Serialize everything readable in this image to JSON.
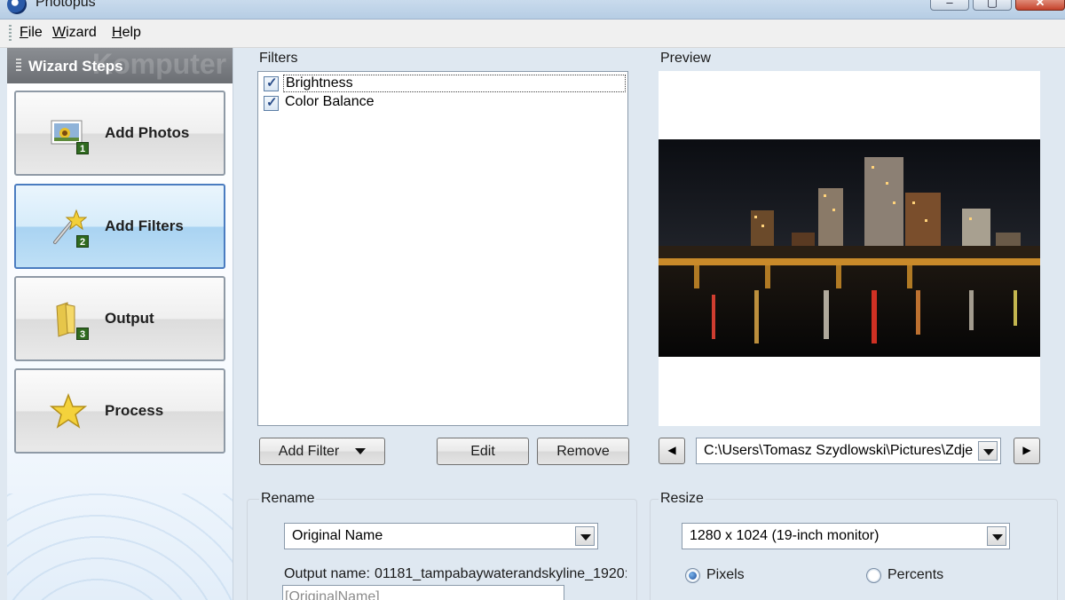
{
  "window": {
    "title": "Photopus",
    "controls": {
      "minimize": "–",
      "maximize": "▢",
      "close": "✕"
    }
  },
  "menu": {
    "items": [
      "File",
      "Wizard",
      "Help"
    ]
  },
  "wizard": {
    "header": "Wizard Steps",
    "watermark": "Komputer",
    "steps": [
      {
        "label": "Add Photos",
        "number": "1",
        "icon": "photo-icon"
      },
      {
        "label": "Add Filters",
        "number": "2",
        "icon": "magic-wand-icon",
        "active": true
      },
      {
        "label": "Output",
        "number": "3",
        "icon": "folder-icon"
      },
      {
        "label": "Process",
        "icon": "star-icon"
      }
    ]
  },
  "filters": {
    "label": "Filters",
    "items": [
      {
        "name": "Brightness",
        "checked": true,
        "selected": true
      },
      {
        "name": "Color Balance",
        "checked": true
      }
    ],
    "buttons": {
      "add": "Add Filter",
      "edit": "Edit",
      "remove": "Remove"
    }
  },
  "preview": {
    "label": "Preview",
    "path": "C:\\Users\\Tomasz Szydlowski\\Pictures\\Zdje",
    "prev": "◀",
    "next": "▶"
  },
  "rename": {
    "label": "Rename",
    "mode": "Original Name",
    "output_label": "Output name:",
    "output_value": "01181_tampabaywaterandskyline_1920:",
    "pattern_placeholder": "[OriginalName]"
  },
  "resize": {
    "label": "Resize",
    "size": "1280 x 1024 (19-inch monitor)",
    "units": [
      {
        "label": "Pixels",
        "selected": true
      },
      {
        "label": "Percents",
        "selected": false
      }
    ]
  }
}
